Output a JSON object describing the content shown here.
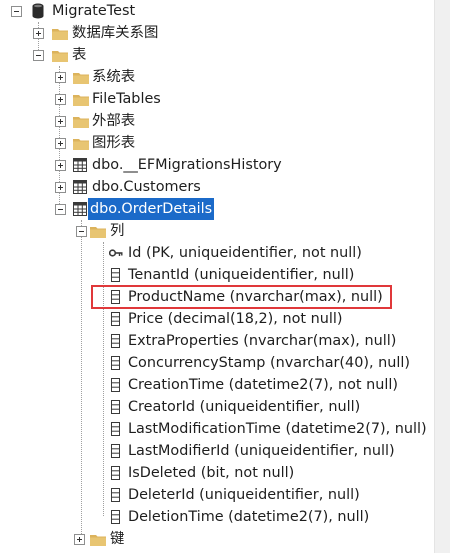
{
  "tree": {
    "root": {
      "label": "MigrateTest",
      "icon": "database-icon"
    },
    "db_diagrams": {
      "label": "数据库关系图",
      "icon": "folder-icon"
    },
    "tables_folder": {
      "label": "表",
      "icon": "folder-icon"
    },
    "system_tables": {
      "label": "系统表",
      "icon": "folder-icon"
    },
    "file_tables": {
      "label": "FileTables",
      "icon": "folder-icon"
    },
    "external_tables": {
      "label": "外部表",
      "icon": "folder-icon"
    },
    "graph_tables": {
      "label": "图形表",
      "icon": "folder-icon"
    },
    "tables": [
      {
        "label": "dbo.__EFMigrationsHistory",
        "icon": "table-icon"
      },
      {
        "label": "dbo.Customers",
        "icon": "table-icon"
      },
      {
        "label": "dbo.OrderDetails",
        "icon": "table-icon",
        "selected": true
      }
    ],
    "columns_folder": {
      "label": "列",
      "icon": "folder-icon"
    },
    "columns": [
      {
        "label": "Id (PK, uniqueidentifier, not null)",
        "icon": "key-icon"
      },
      {
        "label": "TenantId (uniqueidentifier, null)",
        "icon": "column-icon"
      },
      {
        "label": "ProductName (nvarchar(max), null)",
        "icon": "column-icon",
        "highlighted": true
      },
      {
        "label": "Price (decimal(18,2), not null)",
        "icon": "column-icon"
      },
      {
        "label": "ExtraProperties (nvarchar(max), null)",
        "icon": "column-icon"
      },
      {
        "label": "ConcurrencyStamp (nvarchar(40), null)",
        "icon": "column-icon"
      },
      {
        "label": "CreationTime (datetime2(7), not null)",
        "icon": "column-icon"
      },
      {
        "label": "CreatorId (uniqueidentifier, null)",
        "icon": "column-icon"
      },
      {
        "label": "LastModificationTime (datetime2(7), null)",
        "icon": "column-icon"
      },
      {
        "label": "LastModifierId (uniqueidentifier, null)",
        "icon": "column-icon"
      },
      {
        "label": "IsDeleted (bit, not null)",
        "icon": "column-icon"
      },
      {
        "label": "DeleterId (uniqueidentifier, null)",
        "icon": "column-icon"
      },
      {
        "label": "DeletionTime (datetime2(7), null)",
        "icon": "column-icon"
      }
    ],
    "keys_folder": {
      "label": "键",
      "icon": "folder-icon"
    }
  },
  "colors": {
    "selection": "#1b6ac9",
    "highlight_border": "#e0383a",
    "folder": "#dcb35c"
  }
}
